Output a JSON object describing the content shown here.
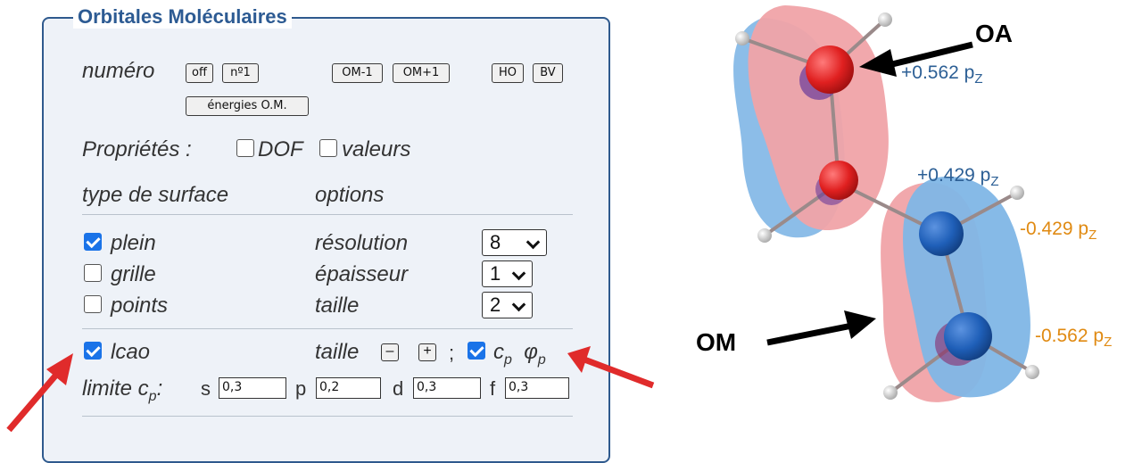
{
  "panel": {
    "legend": "Orbitales Moléculaires",
    "numero_label": "numéro",
    "buttons": [
      "off",
      "nº1",
      "OM-1",
      "OM+1",
      "HO",
      "BV",
      "énergies O.M."
    ],
    "proprietes_label": "Propriétés :",
    "dof_label": "DOF",
    "valeurs_label": "valeurs",
    "type_surface_label": "type de surface",
    "options_label": "options",
    "surface_types": [
      {
        "label": "plein",
        "checked": true
      },
      {
        "label": "grille",
        "checked": false
      },
      {
        "label": "points",
        "checked": false
      }
    ],
    "option_rows": [
      {
        "label": "résolution",
        "value": "8"
      },
      {
        "label": "épaisseur",
        "value": "1"
      },
      {
        "label": "taille",
        "value": "2"
      }
    ],
    "lcao_label": "lcao",
    "lcao_checked": true,
    "taille_label": "taille",
    "minus": "–",
    "plus": "+",
    "semicolon": ";",
    "cp_phi_checked": true,
    "cp_label": "c",
    "phi_label": "φ",
    "sub_p": "p",
    "limite_label": "limite c",
    "limite_colon": ":",
    "limits": [
      {
        "key": "s",
        "value": "0,3"
      },
      {
        "key": "p",
        "value": "0,2"
      },
      {
        "key": "d",
        "value": "0,3"
      },
      {
        "key": "f",
        "value": "0,3"
      }
    ]
  },
  "molecule": {
    "labels": {
      "oa": "OA",
      "om": "OM",
      "c1": "+0.562",
      "c2": "+0.429",
      "c3": "-0.429",
      "c4": "-0.562",
      "orbital": "p",
      "orbital_sub": "Z"
    },
    "colors": {
      "positive_label": "#2c5f95",
      "negative_label": "#e08a12",
      "lobe_red": "#f0a3a8",
      "lobe_blue": "#7fb6e6",
      "atom_red": "#e02020",
      "atom_blue": "#1f5fb8",
      "annotation_arrow": "#e02b2b"
    }
  }
}
